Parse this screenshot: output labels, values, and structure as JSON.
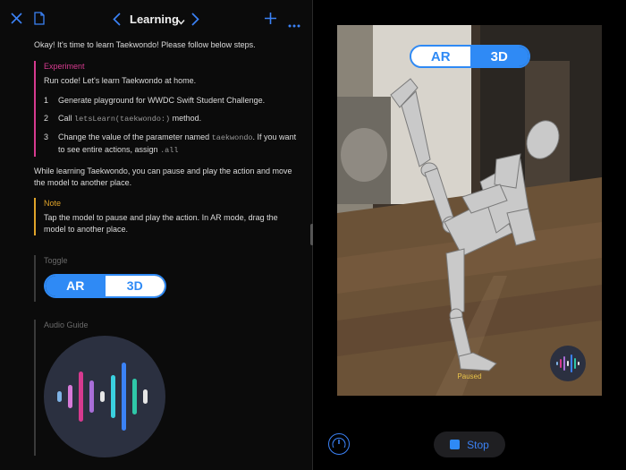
{
  "toolbar": {
    "title": "Learning",
    "icons": [
      "close-icon",
      "document-icon",
      "chevron-left-icon",
      "chevron-down-icon",
      "chevron-right-icon",
      "plus-icon",
      "more-icon"
    ],
    "accent": "#3b82f6"
  },
  "page": {
    "intro": "Okay! It's time to learn Taekwondo! Please follow below steps.",
    "experiment": {
      "title": "Experiment",
      "lead": "Run code! Let's learn Taekwondo at home.",
      "steps": [
        {
          "num": "1",
          "text": "Generate playground for WWDC Swift Student Challenge."
        },
        {
          "num": "2",
          "pre": "Call ",
          "code": "letsLearn(taekwondo:)",
          "post": " method."
        },
        {
          "num": "3",
          "pre": "Change the value of the parameter named ",
          "code": "taekwondo",
          "mid": ". If you want to see entire actions, assign ",
          "code2": ".all"
        }
      ],
      "color": "#d63a8f"
    },
    "paragraph": "While learning Taekwondo, you can pause and play the action and move the model to another place.",
    "note": {
      "title": "Note",
      "text": "Tap the model to pause and play the action. In AR mode, drag the model to another place.",
      "color": "#e0a42a"
    },
    "toggle_section": {
      "label": "Toggle",
      "ar": "AR",
      "threed": "3D",
      "selected": "AR"
    },
    "audio_section": {
      "label": "Audio Guide",
      "icon": "waveform-icon"
    }
  },
  "live_view": {
    "toggle": {
      "ar": "AR",
      "threed": "3D",
      "selected": "3D"
    },
    "status": "Paused",
    "audio_button_icon": "waveform-icon"
  },
  "bottom": {
    "stop_label": "Stop",
    "gauge_icon": "speedometer-icon"
  }
}
